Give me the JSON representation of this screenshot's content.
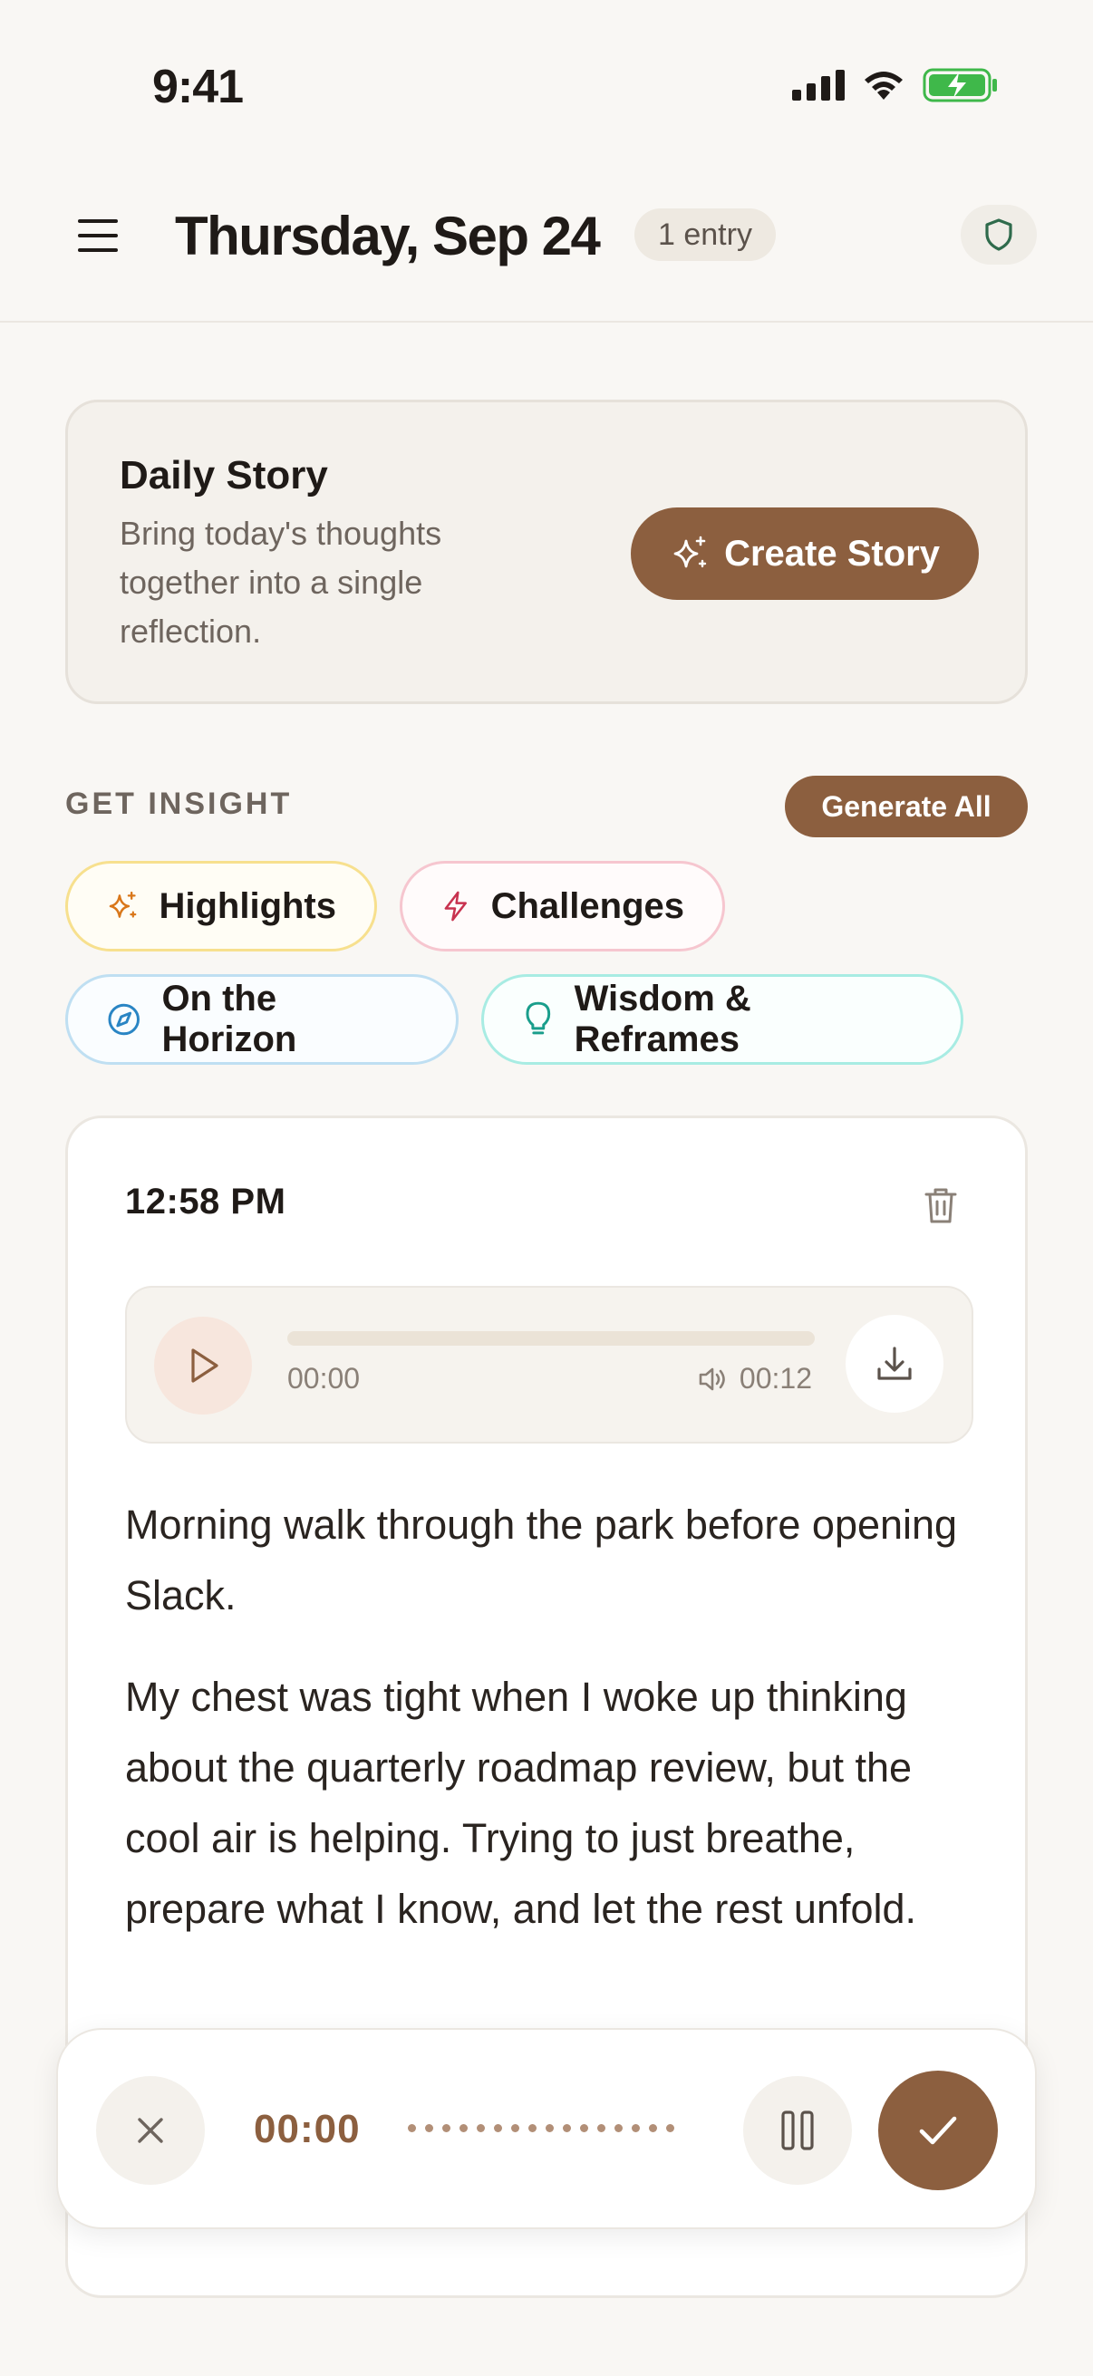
{
  "status_bar": {
    "time": "9:41",
    "icons": [
      "signal-icon",
      "wifi-icon",
      "battery-charging-icon"
    ]
  },
  "header": {
    "title": "Thursday, Sep 24",
    "entry_count": "1 entry",
    "icons": [
      "menu-icon",
      "shield-icon"
    ]
  },
  "daily_story": {
    "title": "Daily Story",
    "description": "Bring today's thoughts together into a single reflection.",
    "button_label": "Create Story",
    "button_icon": "sparkles-icon"
  },
  "insight": {
    "label": "GET INSIGHT",
    "generate_all_label": "Generate All",
    "chips": [
      {
        "label": "Highlights",
        "icon": "sparkles-icon",
        "color": "#d9771a"
      },
      {
        "label": "Challenges",
        "icon": "lightning-icon",
        "color": "#c8324f"
      },
      {
        "label": "On the Horizon",
        "icon": "compass-icon",
        "color": "#2a85c4"
      },
      {
        "label": "Wisdom & Reframes",
        "icon": "lightbulb-icon",
        "color": "#1a9e8c"
      }
    ]
  },
  "entry": {
    "time": "12:58 PM",
    "audio": {
      "current_time": "00:00",
      "duration": "00:12",
      "progress": 0
    },
    "paragraphs": [
      "Morning walk through the park before opening Slack.",
      "My chest was tight when I woke up thinking about the quarterly roadmap review, but the cool air is helping. Trying to just breathe, prepare what I know, and let the rest unfold."
    ]
  },
  "recorder": {
    "time": "00:00",
    "icons": [
      "close-icon",
      "pause-icon",
      "check-icon"
    ]
  },
  "colors": {
    "accent": "#8c5f3f",
    "background": "#f9f7f4",
    "card": "#ffffff"
  }
}
